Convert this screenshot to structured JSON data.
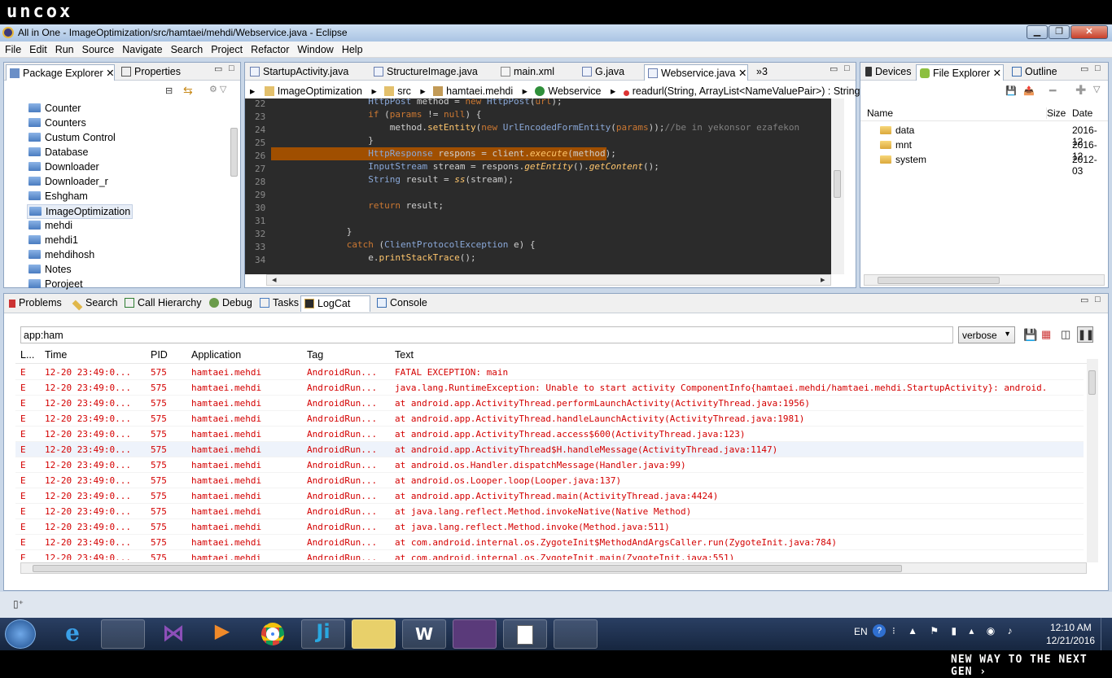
{
  "brand": {
    "logo": "uncox",
    "tagline": "NEW WAY TO THE NEXT GEN ›"
  },
  "window": {
    "title": "All in One - ImageOptimization/src/hamtaei/mehdi/Webservice.java - Eclipse"
  },
  "menu": [
    "File",
    "Edit",
    "Run",
    "Source",
    "Navigate",
    "Search",
    "Project",
    "Refactor",
    "Window",
    "Help"
  ],
  "left_panel": {
    "tabs": [
      "Package Explorer",
      "Properties"
    ],
    "items": [
      "Counter",
      "Counters",
      "Custum Control",
      "Database",
      "Downloader",
      "Downloader_r",
      "Eshgham",
      "ImageOptimization",
      "mehdi",
      "mehdi1",
      "mehdihosh",
      "Notes",
      "Porojeet"
    ],
    "selected": "ImageOptimization"
  },
  "editor": {
    "tabs": [
      "StartupActivity.java",
      "StructureImage.java",
      "main.xml",
      "G.java",
      "Webservice.java"
    ],
    "overflow": "»3",
    "active": "Webservice.java",
    "breadcrumb": [
      "ImageOptimization",
      "src",
      "hamtaei.mehdi",
      "Webservice",
      "readurl(String, ArrayList<NameValuePair>) : String"
    ],
    "line_numbers": [
      "22",
      "23",
      "24",
      "25",
      "26",
      "27",
      "28",
      "29",
      "30",
      "31",
      "32",
      "33",
      "34"
    ]
  },
  "right_panel": {
    "tabs": [
      "Devices",
      "File Explorer",
      "Outline"
    ],
    "active": "File Explorer",
    "columns": [
      "Name",
      "Size",
      "Date"
    ],
    "rows": [
      {
        "name": "data",
        "date": "2016-12"
      },
      {
        "name": "mnt",
        "date": "2016-12"
      },
      {
        "name": "system",
        "date": "2012-03"
      }
    ]
  },
  "bottom_panel": {
    "tabs": [
      "Problems",
      "Search",
      "Call Hierarchy",
      "Debug",
      "Tasks",
      "LogCat",
      "Console"
    ],
    "active": "LogCat",
    "filter": "app:ham",
    "level": "verbose",
    "columns": [
      "L...",
      "Time",
      "PID",
      "Application",
      "Tag",
      "Text"
    ],
    "rows": [
      {
        "l": "E",
        "time": "12-20 23:49:0...",
        "pid": "575",
        "app": "hamtaei.mehdi",
        "tag": "AndroidRun...",
        "text": "FATAL EXCEPTION: main"
      },
      {
        "l": "E",
        "time": "12-20 23:49:0...",
        "pid": "575",
        "app": "hamtaei.mehdi",
        "tag": "AndroidRun...",
        "text": "java.lang.RuntimeException: Unable to start activity ComponentInfo{hamtaei.mehdi/hamtaei.mehdi.StartupActivity}: android."
      },
      {
        "l": "E",
        "time": "12-20 23:49:0...",
        "pid": "575",
        "app": "hamtaei.mehdi",
        "tag": "AndroidRun...",
        "text": "at android.app.ActivityThread.performLaunchActivity(ActivityThread.java:1956)"
      },
      {
        "l": "E",
        "time": "12-20 23:49:0...",
        "pid": "575",
        "app": "hamtaei.mehdi",
        "tag": "AndroidRun...",
        "text": "at android.app.ActivityThread.handleLaunchActivity(ActivityThread.java:1981)"
      },
      {
        "l": "E",
        "time": "12-20 23:49:0...",
        "pid": "575",
        "app": "hamtaei.mehdi",
        "tag": "AndroidRun...",
        "text": "at android.app.ActivityThread.access$600(ActivityThread.java:123)"
      },
      {
        "l": "E",
        "time": "12-20 23:49:0...",
        "pid": "575",
        "app": "hamtaei.mehdi",
        "tag": "AndroidRun...",
        "text": "at android.app.ActivityThread$H.handleMessage(ActivityThread.java:1147)"
      },
      {
        "l": "E",
        "time": "12-20 23:49:0...",
        "pid": "575",
        "app": "hamtaei.mehdi",
        "tag": "AndroidRun...",
        "text": "at android.os.Handler.dispatchMessage(Handler.java:99)"
      },
      {
        "l": "E",
        "time": "12-20 23:49:0...",
        "pid": "575",
        "app": "hamtaei.mehdi",
        "tag": "AndroidRun...",
        "text": "at android.os.Looper.loop(Looper.java:137)"
      },
      {
        "l": "E",
        "time": "12-20 23:49:0...",
        "pid": "575",
        "app": "hamtaei.mehdi",
        "tag": "AndroidRun...",
        "text": "at android.app.ActivityThread.main(ActivityThread.java:4424)"
      },
      {
        "l": "E",
        "time": "12-20 23:49:0...",
        "pid": "575",
        "app": "hamtaei.mehdi",
        "tag": "AndroidRun...",
        "text": "at java.lang.reflect.Method.invokeNative(Native Method)"
      },
      {
        "l": "E",
        "time": "12-20 23:49:0...",
        "pid": "575",
        "app": "hamtaei.mehdi",
        "tag": "AndroidRun...",
        "text": "at java.lang.reflect.Method.invoke(Method.java:511)"
      },
      {
        "l": "E",
        "time": "12-20 23:49:0...",
        "pid": "575",
        "app": "hamtaei.mehdi",
        "tag": "AndroidRun...",
        "text": "at com.android.internal.os.ZygoteInit$MethodAndArgsCaller.run(ZygoteInit.java:784)"
      },
      {
        "l": "E",
        "time": "12-20 23:49:0...",
        "pid": "575",
        "app": "hamtaei.mehdi",
        "tag": "AndroidRun...",
        "text": "at com.android.internal.os.ZygoteInit.main(ZygoteInit.java:551)"
      }
    ]
  },
  "taskbar": {
    "lang": "EN",
    "time": "12:10 AM",
    "date": "12/21/2016"
  }
}
